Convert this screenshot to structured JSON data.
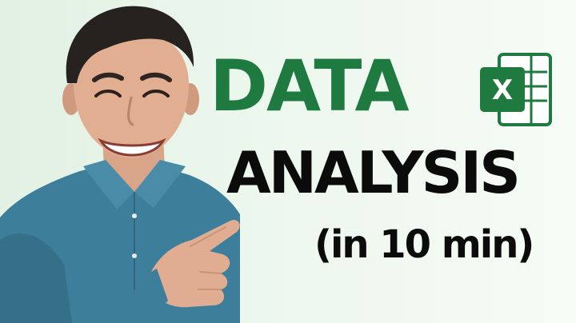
{
  "thumbnail": {
    "title_line1": "DATA",
    "title_line2": "ANALYSIS",
    "subtitle": "(in 10 min)",
    "logo_letter": "X",
    "icons": {
      "app_logo": "excel-logo-icon",
      "pointing_hand": "pointing-hand-icon"
    },
    "colors": {
      "background": "#e2f1e3",
      "title_line1": "#1e7a3f",
      "title_line2": "#0b0b0b",
      "subtitle": "#0b0b0b",
      "excel_green": "#1e7a3f",
      "shirt": "#3d7f9a"
    }
  }
}
